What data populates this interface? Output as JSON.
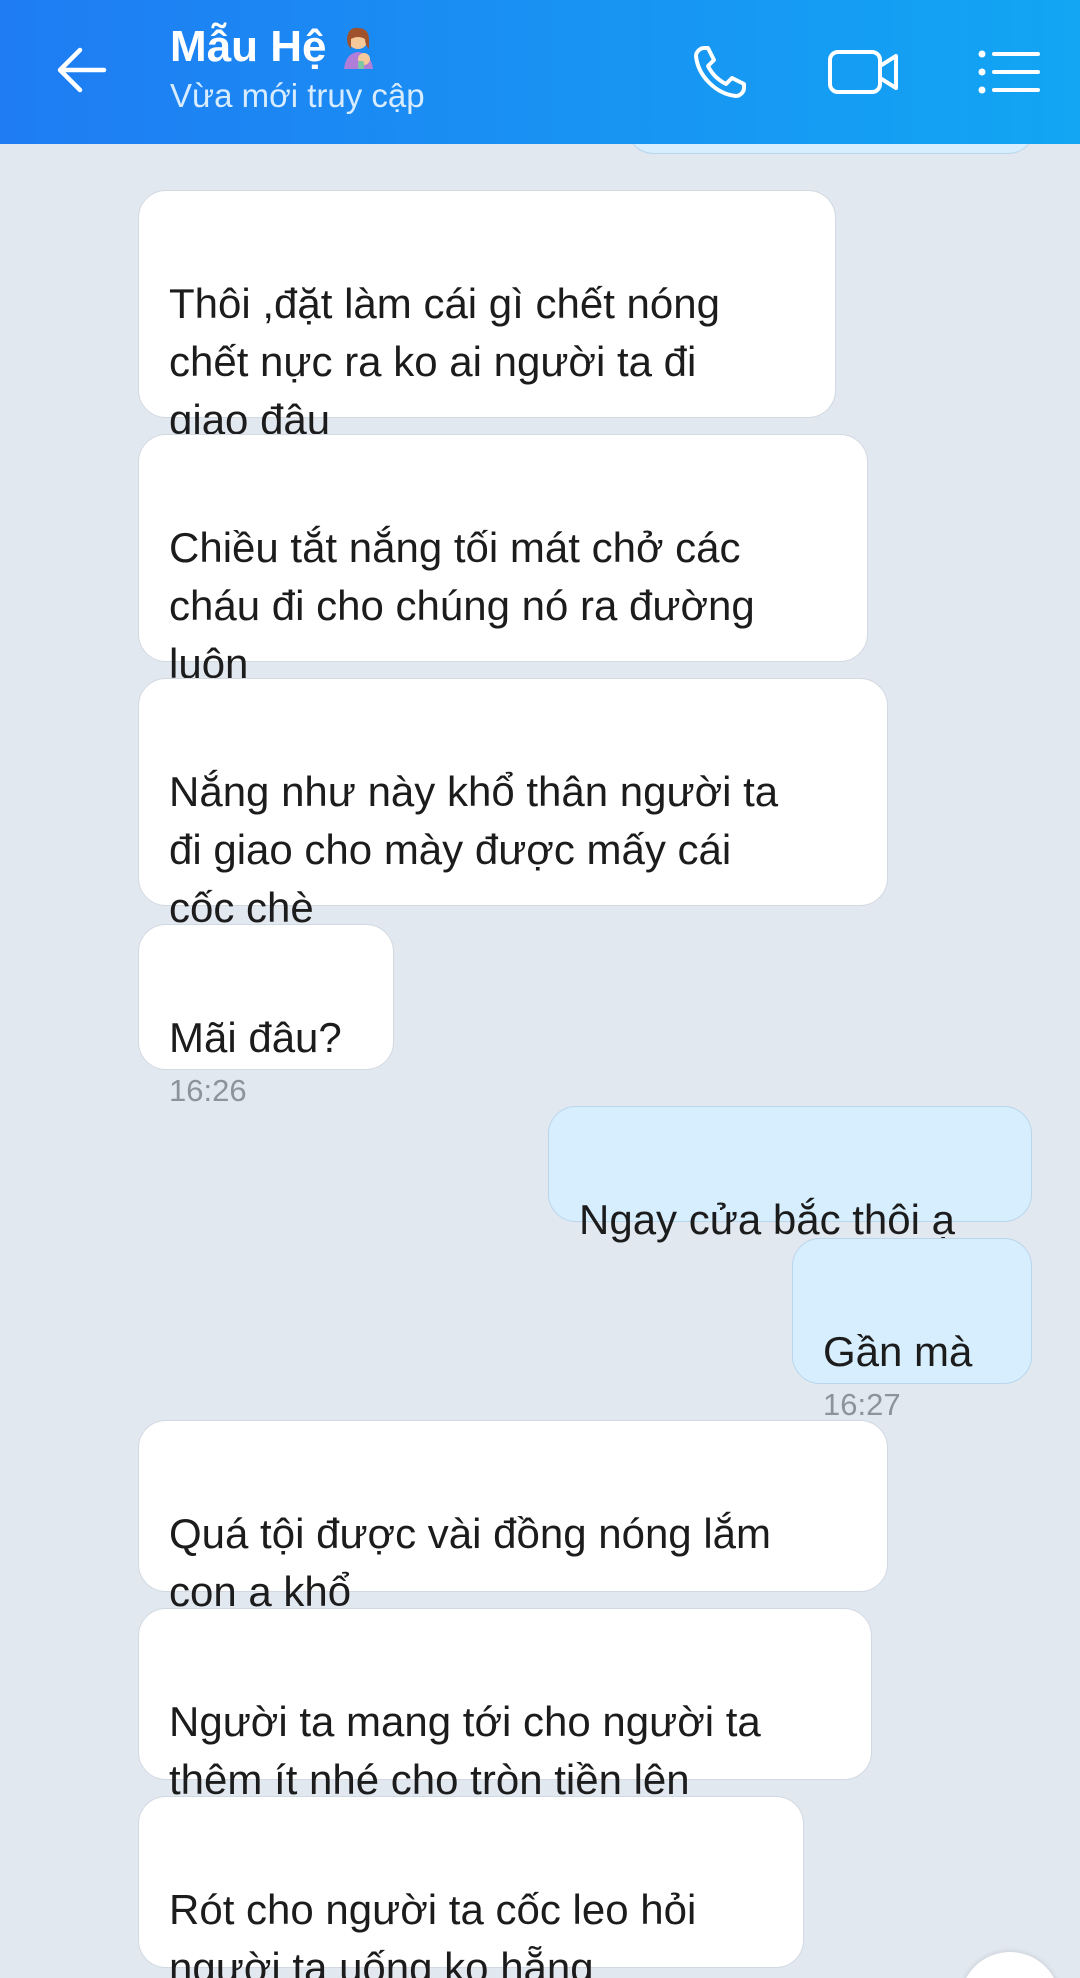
{
  "header": {
    "contact_name": "Mẫu Hệ",
    "status": "Vừa mới truy cập",
    "icons": {
      "back": "arrow-left-icon",
      "call": "phone-icon",
      "video": "video-camera-icon",
      "menu": "list-menu-icon",
      "avatar_emoji": "woman-feeding-baby-emoji"
    },
    "color_start": "#1f7cf3",
    "color_end": "#12a6f3"
  },
  "messages": [
    {
      "sender": "contact",
      "text": "Thôi ,đặt làm cái gì chết nóng\nchết nực ra ko ai người ta đi\ngiao đâu",
      "time": ""
    },
    {
      "sender": "contact",
      "text": "Chiều tắt nắng tối mát chở các\ncháu đi cho chúng nó ra đường\nluôn",
      "time": ""
    },
    {
      "sender": "contact",
      "text": "Nắng như này khổ thân người ta\nđi giao cho mày được mấy cái\ncốc chè",
      "time": ""
    },
    {
      "sender": "contact",
      "text": "Mãi đâu?",
      "time": "16:26"
    },
    {
      "sender": "me",
      "text": "Ngay cửa bắc thôi ạ",
      "time": ""
    },
    {
      "sender": "me",
      "text": "Gần mà",
      "time": "16:27"
    },
    {
      "sender": "contact",
      "text": "Quá tội được vài đồng nóng lắm\ncon ạ khổ",
      "time": ""
    },
    {
      "sender": "contact",
      "text": "Người ta mang tới cho người ta\nthêm ít nhé cho tròn tiền lên",
      "time": ""
    },
    {
      "sender": "contact",
      "text": "Rót cho người ta cốc leo hỏi\nngười ta uống ko hẵng",
      "time": ""
    }
  ],
  "colors": {
    "background": "#e2e8f0",
    "bubble_contact": "#ffffff",
    "bubble_me": "#d6eefe",
    "time_text": "#8b949d"
  }
}
